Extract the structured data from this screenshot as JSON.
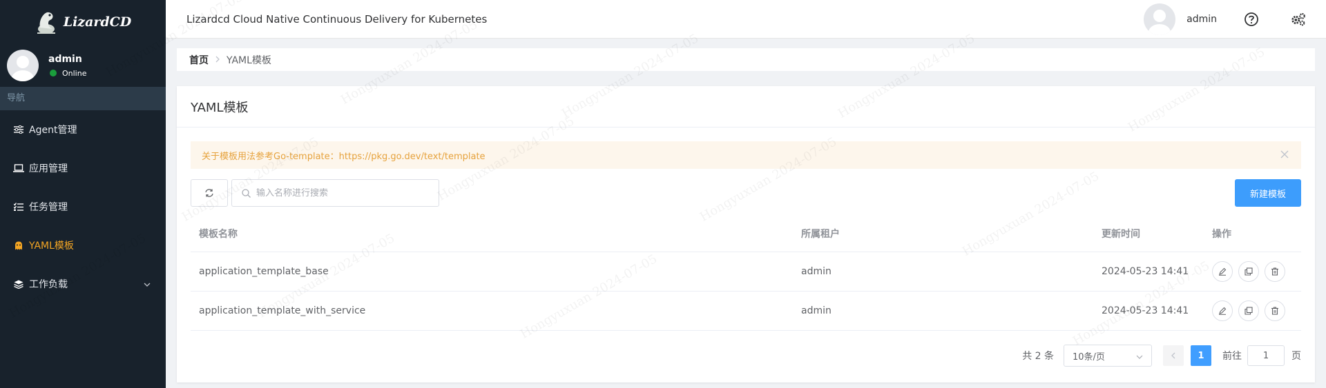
{
  "sidebar": {
    "logo_text": "LizardCD",
    "user": {
      "name": "admin",
      "status": "Online"
    },
    "nav_header": "导航",
    "items": [
      {
        "label": "Agent管理",
        "icon": "sliders-icon",
        "active": false
      },
      {
        "label": "应用管理",
        "icon": "laptop-icon",
        "active": false
      },
      {
        "label": "任务管理",
        "icon": "tasks-icon",
        "active": false
      },
      {
        "label": "YAML模板",
        "icon": "ghost-icon",
        "active": true
      },
      {
        "label": "工作负载",
        "icon": "layers-icon",
        "active": false,
        "expandable": true
      }
    ]
  },
  "topbar": {
    "title": "Lizardcd Cloud Native Continuous Delivery for Kubernetes",
    "user": "admin"
  },
  "breadcrumb": {
    "home": "首页",
    "current": "YAML模板"
  },
  "panel": {
    "title": "YAML模板",
    "alert": "关于模板用法参考Go-template：https://pkg.go.dev/text/template",
    "search_placeholder": "输入名称进行搜索",
    "new_button": "新建模板"
  },
  "table": {
    "headers": [
      "模板名称",
      "所属租户",
      "更新时间",
      "操作"
    ],
    "rows": [
      {
        "name": "application_template_base",
        "tenant": "admin",
        "updated": "2024-05-23 14:41"
      },
      {
        "name": "application_template_with_service",
        "tenant": "admin",
        "updated": "2024-05-23 14:41"
      }
    ]
  },
  "pagination": {
    "total": "共 2 条",
    "page_size": "10条/页",
    "current_page": "1",
    "goto_label": "前往",
    "goto_value": "1",
    "page_suffix": "页"
  },
  "watermark": "Hongyuxuan 2024-07-05",
  "colors": {
    "sidebar_bg": "#18222c",
    "accent": "#409eff",
    "active_nav": "#f5a623",
    "alert_bg": "#fdf6ec",
    "alert_text": "#e6a23c"
  }
}
